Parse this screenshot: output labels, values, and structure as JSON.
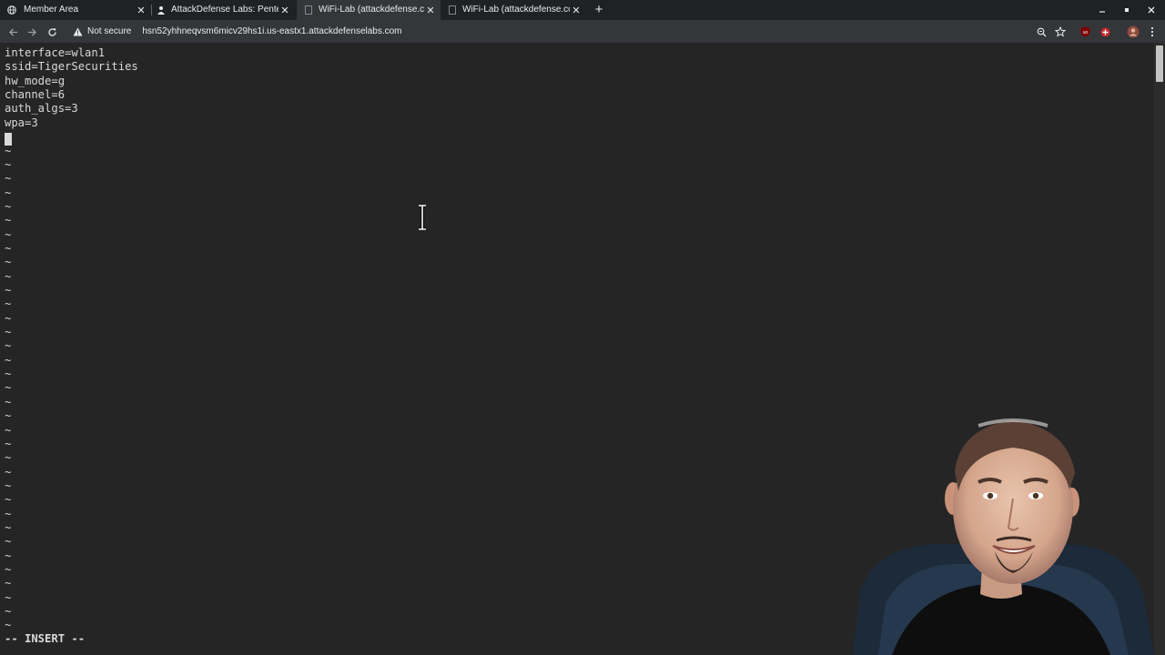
{
  "tabs": [
    {
      "title": "Member Area",
      "icon": "globe-icon",
      "active": false
    },
    {
      "title": "AttackDefense Labs: Pente",
      "icon": "person-icon",
      "active": false
    },
    {
      "title": "WiFi-Lab (attackdefense.co",
      "icon": "page-icon",
      "active": true
    },
    {
      "title": "WiFi-Lab (attackdefense.co",
      "icon": "page-icon",
      "active": false
    }
  ],
  "toolbar": {
    "security_label": "Not secure",
    "url": "hsn52yhhneqvsm6micv29hs1i.us-eastx1.attackdefenselabs.com"
  },
  "editor": {
    "lines": [
      "interface=wlan1",
      "ssid=TigerSecurities",
      "hw_mode=g",
      "channel=6",
      "auth_algs=3",
      "wpa=3"
    ],
    "empty_line_marker": "~",
    "mode": "-- INSERT --"
  },
  "colors": {
    "terminal_bg": "#252525",
    "terminal_fg": "#d9d9d9",
    "tabstrip_bg": "#202124",
    "toolbar_bg": "#35363a"
  }
}
